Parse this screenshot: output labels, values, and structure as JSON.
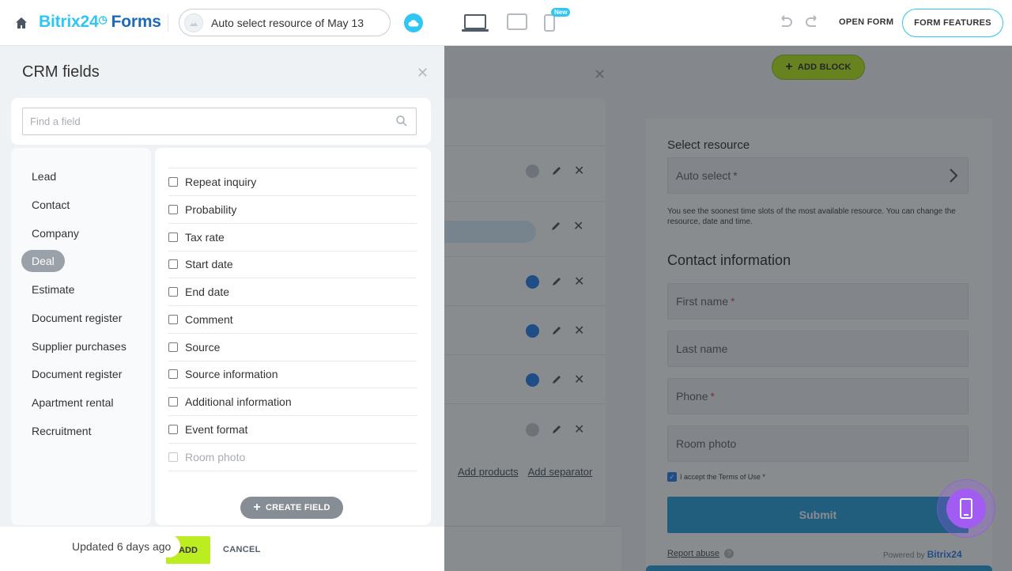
{
  "header": {
    "brand_main": "Bitrix24",
    "brand_clock": "◷",
    "brand_forms": "Forms",
    "form_title": "Auto select resource of May 13",
    "new_badge": "New",
    "open_form": "OPEN FORM",
    "form_features": "FORM FEATURES"
  },
  "panel": {
    "title": "CRM fields",
    "search_placeholder": "Find a field",
    "categories": [
      "Lead",
      "Contact",
      "Company",
      "Deal",
      "Estimate",
      "Document register",
      "Supplier purchases",
      "Document register",
      "Apartment rental",
      "Recruitment"
    ],
    "active_category": "Deal",
    "fields": [
      "Repeat inquiry",
      "Probability",
      "Tax rate",
      "Start date",
      "End date",
      "Comment",
      "Source",
      "Source information",
      "Additional information",
      "Event format",
      "Room photo"
    ],
    "create_field": "CREATE FIELD",
    "add": "ADD",
    "cancel": "CANCEL",
    "toast": "Updated 6 days ago"
  },
  "middle": {
    "add_products": "Add products",
    "add_separator": "Add separator"
  },
  "preview": {
    "add_block": "ADD BLOCK",
    "select_resource": "Select resource",
    "auto_select": "Auto select",
    "note": "You see the soonest time slots of the most available resource. You can change the resource, date and time.",
    "contact_heading": "Contact information",
    "first_name": "First name",
    "last_name": "Last name",
    "phone": "Phone",
    "room_photo": "Room photo",
    "accept": "I accept the Terms of Use",
    "submit": "Submit",
    "report_abuse": "Report abuse",
    "powered_by": "Powered by",
    "powered_brand": "Bitrix24"
  },
  "colors": {
    "accent": "#2fc6f6",
    "brand_dark": "#1f6ab5",
    "green": "#bbed21",
    "submit": "#2fa2dc",
    "fab": "#a35cf2"
  }
}
